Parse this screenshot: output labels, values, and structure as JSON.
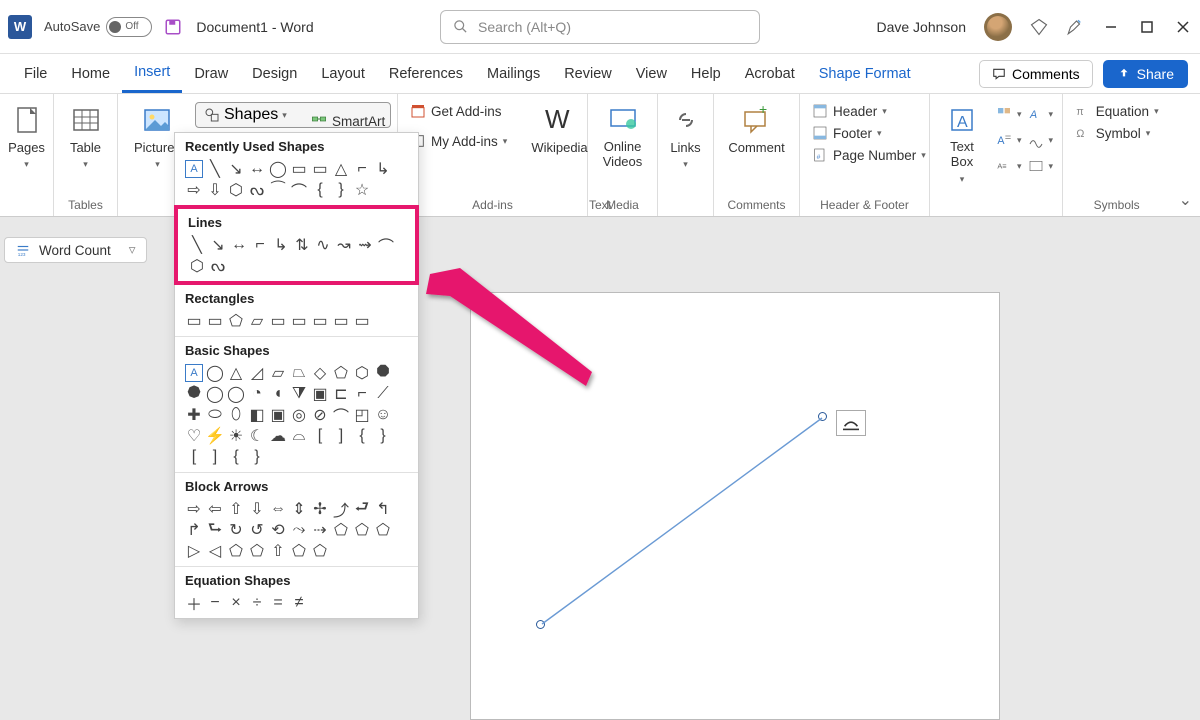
{
  "title_bar": {
    "autosave_label": "AutoSave",
    "autosave_state": "Off",
    "doc_title": "Document1 - Word",
    "search_placeholder": "Search (Alt+Q)",
    "user_name": "Dave Johnson"
  },
  "tabs": {
    "file": "File",
    "home": "Home",
    "insert": "Insert",
    "draw": "Draw",
    "design": "Design",
    "layout": "Layout",
    "references": "References",
    "mailings": "Mailings",
    "review": "Review",
    "view": "View",
    "help": "Help",
    "acrobat": "Acrobat",
    "shape_format": "Shape Format",
    "comments": "Comments",
    "share": "Share"
  },
  "ribbon": {
    "pages": "Pages",
    "table": "Table",
    "tables_grp": "Tables",
    "pictures": "Pictures",
    "shapes": "Shapes",
    "smartart": "SmartArt",
    "get_addins": "Get Add-ins",
    "my_addins": "My Add-ins",
    "wikipedia": "Wikipedia",
    "addins_grp": "Add-ins",
    "online_videos": "Online\nVideos",
    "media_grp": "Media",
    "links": "Links",
    "comment": "Comment",
    "comments_grp": "Comments",
    "header": "Header",
    "footer": "Footer",
    "page_number": "Page Number",
    "hf_grp": "Header & Footer",
    "text_box": "Text\nBox",
    "text_grp": "Text",
    "equation": "Equation",
    "symbol": "Symbol",
    "symbols_grp": "Symbols"
  },
  "shapes_menu": {
    "recently_used": "Recently Used Shapes",
    "lines": "Lines",
    "rectangles": "Rectangles",
    "basic_shapes": "Basic Shapes",
    "block_arrows": "Block Arrows",
    "equation_shapes": "Equation Shapes"
  },
  "wc": {
    "label": "Word Count"
  }
}
